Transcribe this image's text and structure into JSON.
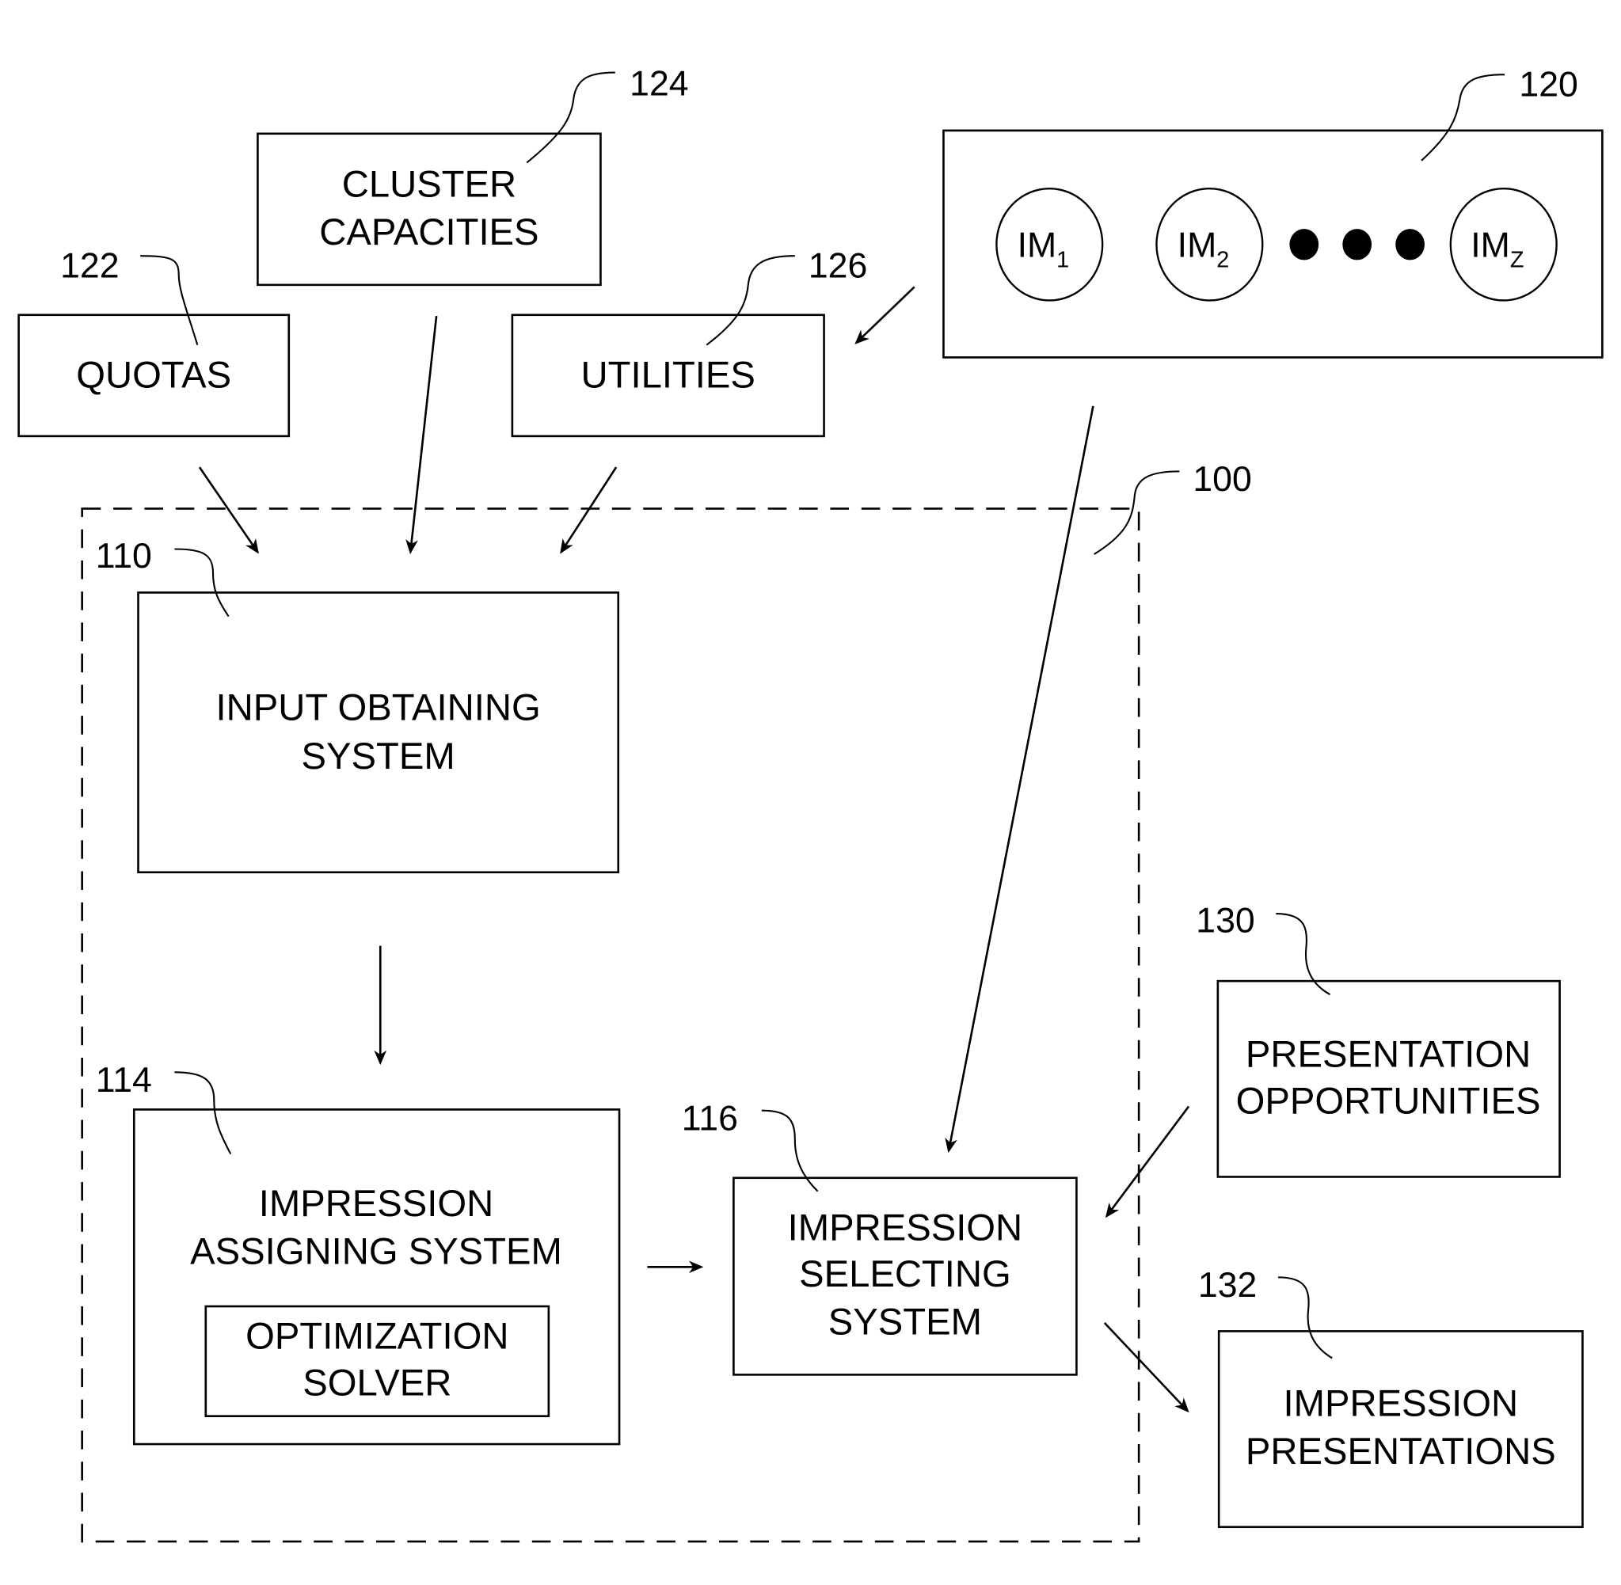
{
  "diagram": {
    "system_ref": "100",
    "boxes": {
      "quotas": {
        "ref": "122",
        "lines": [
          "QUOTAS"
        ]
      },
      "cluster_capacities": {
        "ref": "124",
        "lines": [
          "CLUSTER",
          "CAPACITIES"
        ]
      },
      "utilities": {
        "ref": "126",
        "lines": [
          "UTILITIES"
        ]
      },
      "impression_models": {
        "ref": "120",
        "items": [
          {
            "label": "IM",
            "sub": "1"
          },
          {
            "label": "IM",
            "sub": "2"
          },
          {
            "label": "IM",
            "sub": "Z"
          }
        ]
      },
      "input_obtaining": {
        "ref": "110",
        "lines": [
          "INPUT OBTAINING",
          "SYSTEM"
        ]
      },
      "impression_assigning": {
        "ref": "114",
        "lines": [
          "IMPRESSION",
          "ASSIGNING SYSTEM"
        ]
      },
      "optimization_solver": {
        "lines": [
          "OPTIMIZATION",
          "SOLVER"
        ]
      },
      "impression_selecting": {
        "ref": "116",
        "lines": [
          "IMPRESSION",
          "SELECTING",
          "SYSTEM"
        ]
      },
      "presentation_opportunities": {
        "ref": "130",
        "lines": [
          "PRESENTATION",
          "OPPORTUNITIES"
        ]
      },
      "impression_presentations": {
        "ref": "132",
        "lines": [
          "IMPRESSION",
          "PRESENTATIONS"
        ]
      }
    }
  }
}
